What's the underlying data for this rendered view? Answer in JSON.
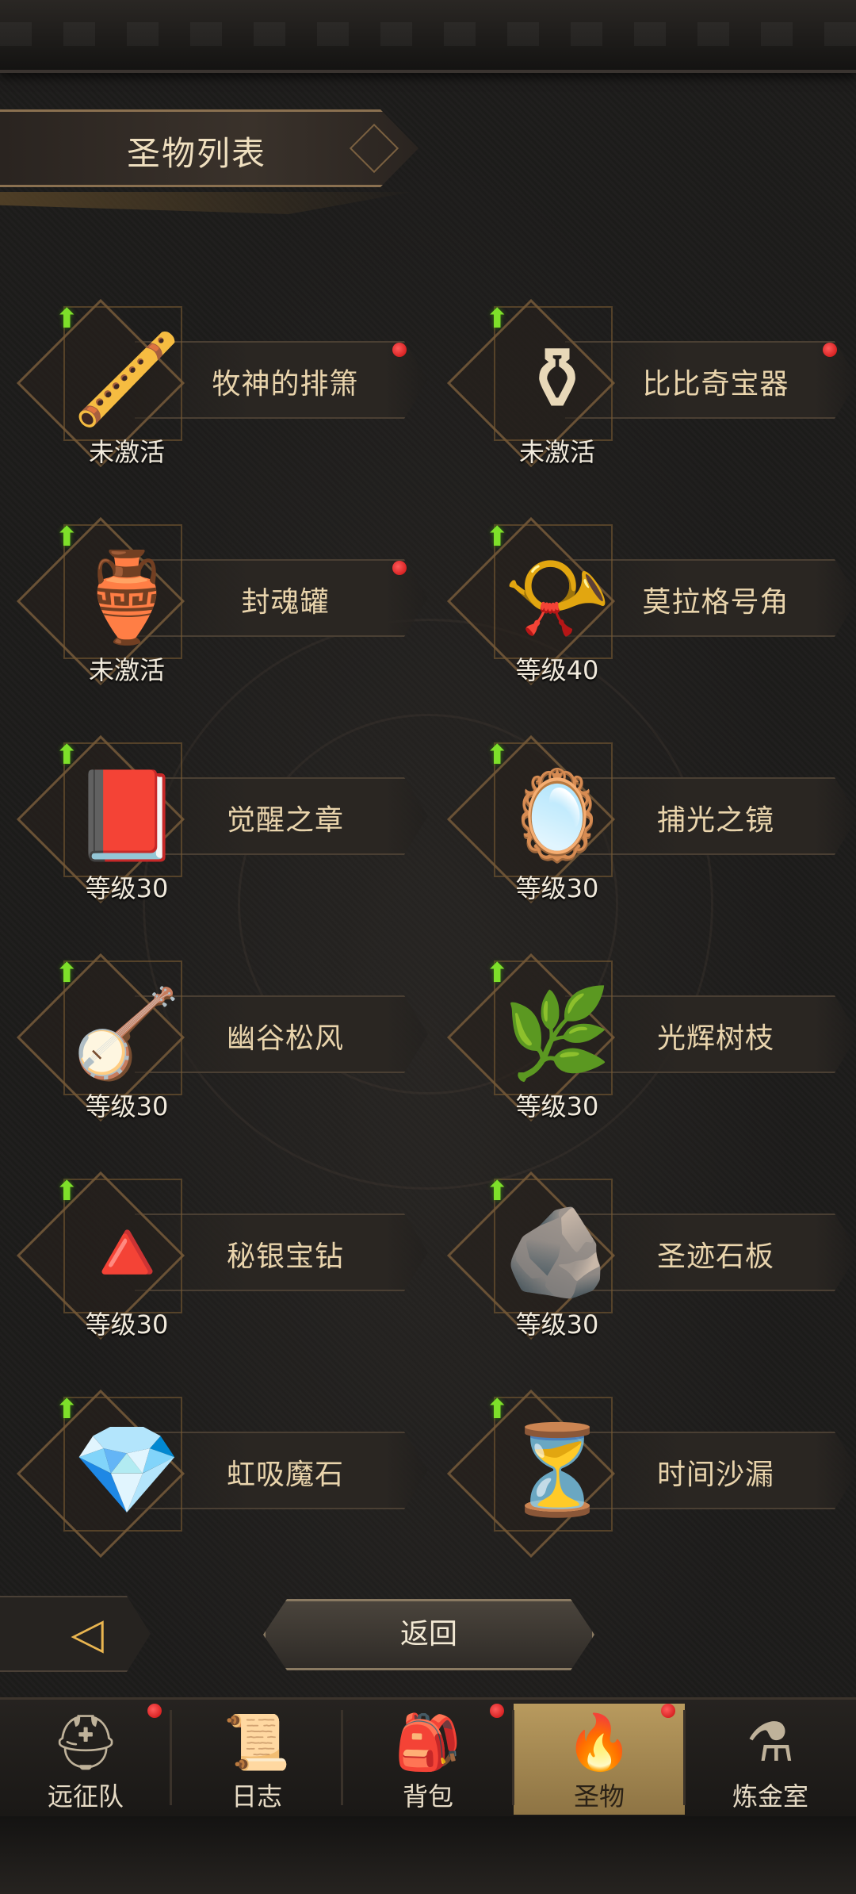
{
  "header": {
    "title": "圣物列表"
  },
  "relics": [
    {
      "name": "牧神的排箫",
      "status": "未激活",
      "has_dot": true,
      "icon": "pan-flute-icon",
      "glyph": "🪈"
    },
    {
      "name": "比比奇宝器",
      "status": "未激活",
      "has_dot": true,
      "icon": "spinning-top-icon",
      "glyph": "⚱"
    },
    {
      "name": "封魂罐",
      "status": "未激活",
      "has_dot": true,
      "icon": "soul-urn-icon",
      "glyph": "🏺"
    },
    {
      "name": "莫拉格号角",
      "status": "等级40",
      "has_dot": false,
      "icon": "horn-icon",
      "glyph": "📯"
    },
    {
      "name": "觉醒之章",
      "status": "等级30",
      "has_dot": false,
      "icon": "tome-icon",
      "glyph": "📕"
    },
    {
      "name": "捕光之镜",
      "status": "等级30",
      "has_dot": false,
      "icon": "mirror-icon",
      "glyph": "🪞"
    },
    {
      "name": "幽谷松风",
      "status": "等级30",
      "has_dot": false,
      "icon": "lute-icon",
      "glyph": "🪕"
    },
    {
      "name": "光辉树枝",
      "status": "等级30",
      "has_dot": false,
      "icon": "branch-icon",
      "glyph": "🌿"
    },
    {
      "name": "秘银宝钻",
      "status": "等级30",
      "has_dot": false,
      "icon": "pyramid-gem-icon",
      "glyph": "🔺"
    },
    {
      "name": "圣迹石板",
      "status": "等级30",
      "has_dot": false,
      "icon": "stone-tablet-icon",
      "glyph": "🪨"
    },
    {
      "name": "虹吸魔石",
      "status": "",
      "has_dot": false,
      "icon": "magic-stone-icon",
      "glyph": "💎"
    },
    {
      "name": "时间沙漏",
      "status": "",
      "has_dot": false,
      "icon": "hourglass-icon",
      "glyph": "⏳"
    }
  ],
  "footer": {
    "return_label": "返回"
  },
  "nav": [
    {
      "label": "远征队",
      "icon": "viking-helmet-icon",
      "glyph": "⛑",
      "has_dot": true,
      "active": false
    },
    {
      "label": "日志",
      "icon": "scroll-icon",
      "glyph": "📜",
      "has_dot": false,
      "active": false
    },
    {
      "label": "背包",
      "icon": "backpack-icon",
      "glyph": "🎒",
      "has_dot": true,
      "active": false
    },
    {
      "label": "圣物",
      "icon": "torch-icon",
      "glyph": "🔥",
      "has_dot": true,
      "active": true
    },
    {
      "label": "炼金室",
      "icon": "alchemy-icon",
      "glyph": "⚗",
      "has_dot": false,
      "active": false
    }
  ],
  "colors": {
    "accent": "#b89a5e",
    "upgrade": "#7ee02a",
    "dot": "#e01818"
  }
}
